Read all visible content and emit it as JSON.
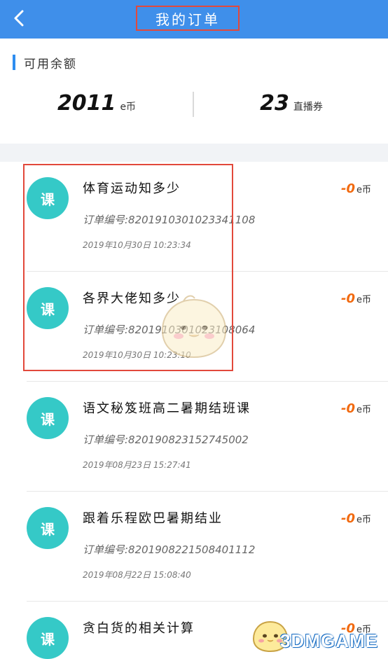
{
  "header": {
    "title": "我的订单",
    "back_icon": "chevron-left-icon"
  },
  "balance": {
    "label": "可用余额",
    "coins": {
      "value": "2011",
      "unit": "e币"
    },
    "vouchers": {
      "value": "23",
      "unit": "直播券"
    }
  },
  "orders": [
    {
      "badge": "课",
      "title": "体育运动知多少",
      "order_no": "订单编号:8201910301023341108",
      "time": "2019年10月30日 10:23:34",
      "price": "-0",
      "price_unit": "e币"
    },
    {
      "badge": "课",
      "title": "各界大佬知多少",
      "order_no": "订单编号:8201910301023108064",
      "time": "2019年10月30日 10:23:10",
      "price": "-0",
      "price_unit": "e币"
    },
    {
      "badge": "课",
      "title": "语文秘笈班高二暑期结班课",
      "order_no": "订单编号:820190823152745002",
      "time": "2019年08月23日 15:27:41",
      "price": "-0",
      "price_unit": "e币"
    },
    {
      "badge": "课",
      "title": "跟着乐程欧巴暑期结业",
      "order_no": "订单编号:8201908221508401112",
      "time": "2019年08月22日 15:08:40",
      "price": "-0",
      "price_unit": "e币"
    },
    {
      "badge": "课",
      "title": "贪白货的相关计算",
      "order_no": "",
      "time": "",
      "price": "-0",
      "price_unit": "e币"
    }
  ],
  "watermark": "3DMGAME",
  "colors": {
    "header_bg": "#3f8fea",
    "accent_bar": "#2d8df0",
    "avatar_bg": "#35c9c7",
    "price": "#f26a10",
    "highlight": "#e2493b"
  }
}
